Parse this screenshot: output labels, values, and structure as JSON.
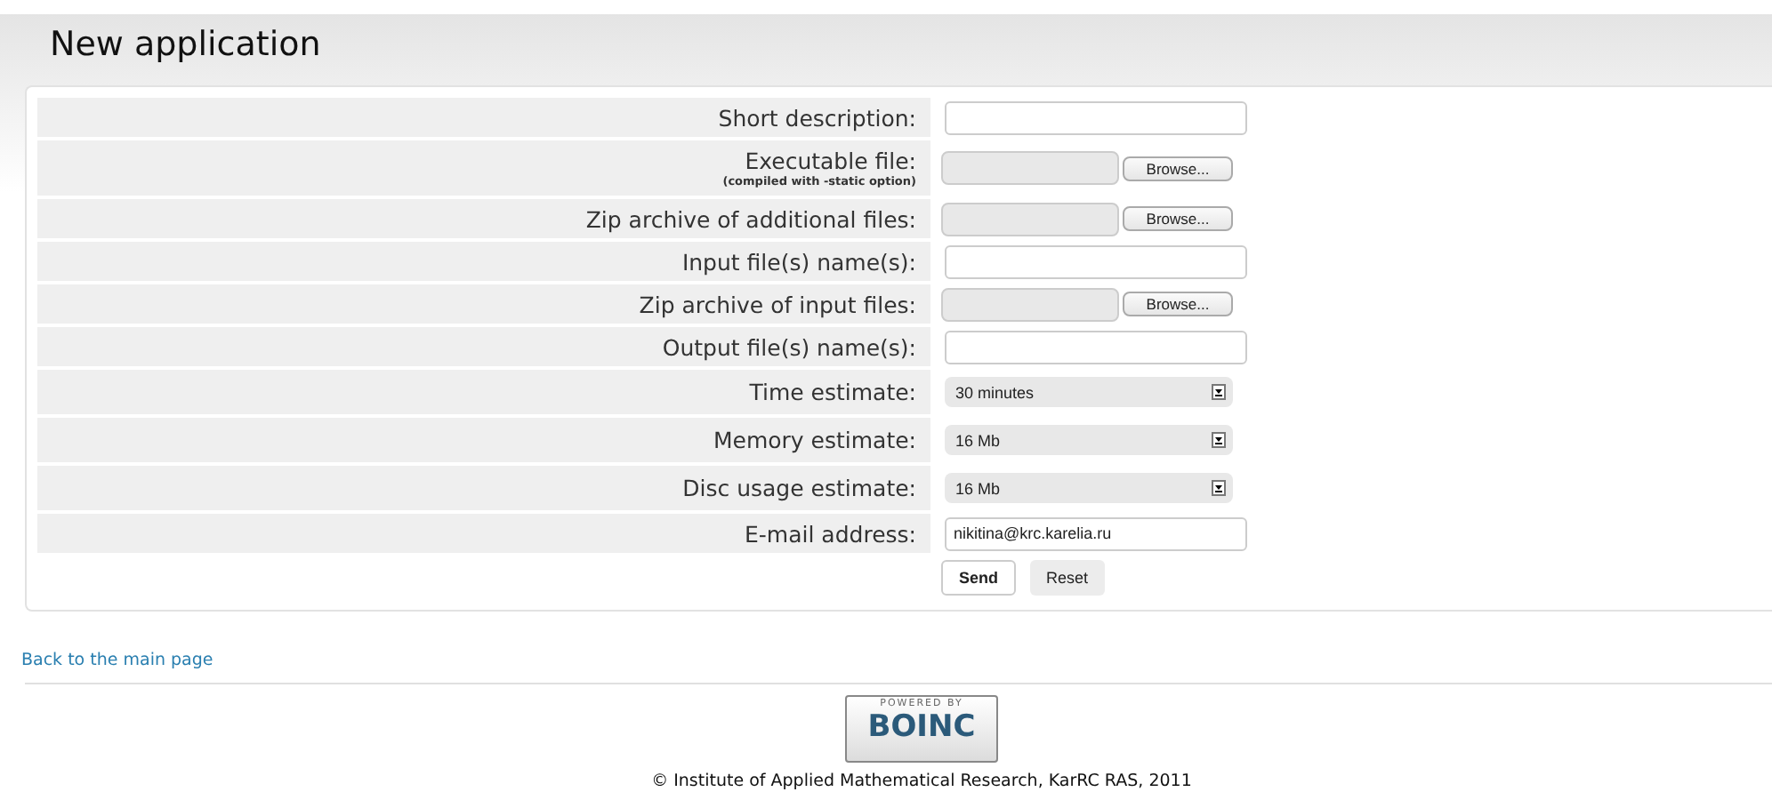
{
  "page": {
    "title": "New application"
  },
  "form": {
    "rows": [
      {
        "kind": "text",
        "label": "Short description:"
      },
      {
        "kind": "file",
        "label": "Executable file:",
        "note": "(compiled with -static option)",
        "button": "Browse..."
      },
      {
        "kind": "file",
        "label": "Zip archive of additional files:",
        "button": "Browse..."
      },
      {
        "kind": "text",
        "label": "Input file(s) name(s):"
      },
      {
        "kind": "file",
        "label": "Zip archive of input files:",
        "button": "Browse..."
      },
      {
        "kind": "text",
        "label": "Output file(s) name(s):"
      },
      {
        "kind": "select",
        "label": "Time estimate:",
        "value": "30 minutes"
      },
      {
        "kind": "select",
        "label": "Memory estimate:",
        "value": "16 Mb"
      },
      {
        "kind": "select",
        "label": "Disc usage estimate:",
        "value": "16 Mb"
      },
      {
        "kind": "text",
        "label": "E-mail address:",
        "value": "nikitina@krc.karelia.ru"
      }
    ],
    "buttons": [
      {
        "label": "Send",
        "primary": true
      },
      {
        "label": "Reset",
        "primary": false
      }
    ]
  },
  "back_link": "Back to the main page",
  "footer": {
    "badge": {
      "caption": "POWERED BY",
      "name": "BOINC"
    },
    "copyright": "© Institute of Applied Mathematical Research, KarRC RAS, 2011"
  }
}
